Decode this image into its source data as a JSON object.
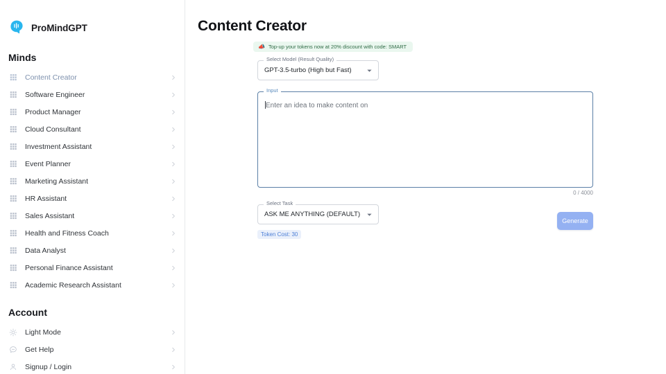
{
  "brand": {
    "name": "ProMindGPT",
    "logo_icon": "brain-logo-icon",
    "logo_color": "#29b6ee"
  },
  "sidebar": {
    "minds_title": "Minds",
    "account_title": "Account",
    "minds": [
      {
        "label": "Content Creator",
        "icon": "grid-apps-icon",
        "active": true
      },
      {
        "label": "Software Engineer",
        "icon": "grid-apps-icon",
        "active": false
      },
      {
        "label": "Product Manager",
        "icon": "grid-apps-icon",
        "active": false
      },
      {
        "label": "Cloud Consultant",
        "icon": "grid-apps-icon",
        "active": false
      },
      {
        "label": "Investment Assistant",
        "icon": "grid-apps-icon",
        "active": false
      },
      {
        "label": "Event Planner",
        "icon": "grid-apps-icon",
        "active": false
      },
      {
        "label": "Marketing Assistant",
        "icon": "grid-apps-icon",
        "active": false
      },
      {
        "label": "HR Assistant",
        "icon": "grid-apps-icon",
        "active": false
      },
      {
        "label": "Sales Assistant",
        "icon": "grid-apps-icon",
        "active": false
      },
      {
        "label": "Health and Fitness Coach",
        "icon": "grid-apps-icon",
        "active": false
      },
      {
        "label": "Data Analyst",
        "icon": "grid-apps-icon",
        "active": false
      },
      {
        "label": "Personal Finance Assistant",
        "icon": "grid-apps-icon",
        "active": false
      },
      {
        "label": "Academic Research Assistant",
        "icon": "grid-apps-icon",
        "active": false
      }
    ],
    "account": [
      {
        "label": "Light Mode",
        "icon": "sun-icon"
      },
      {
        "label": "Get Help",
        "icon": "chat-help-icon"
      },
      {
        "label": "Signup / Login",
        "icon": "person-icon"
      }
    ]
  },
  "main": {
    "page_title": "Content Creator",
    "promo": {
      "icon": "megaphone-icon",
      "text": "Top-up your tokens now at 20% discount with code: SMART",
      "bg_color": "#eaf7ef",
      "text_color": "#2f6b45"
    },
    "model_select": {
      "label": "Select Model (Result Quality)",
      "value": "GPT-3.5-turbo (High but Fast)"
    },
    "input": {
      "label": "Input",
      "placeholder": "Enter an idea to make content on",
      "value": "",
      "counter": "0 / 4000"
    },
    "task_select": {
      "label": "Select Task",
      "value": "ASK ME ANYTHING (DEFAULT)"
    },
    "token_cost": "Token Cost: 30",
    "generate_button": "Generate",
    "accent_color": "#94b1f2"
  }
}
